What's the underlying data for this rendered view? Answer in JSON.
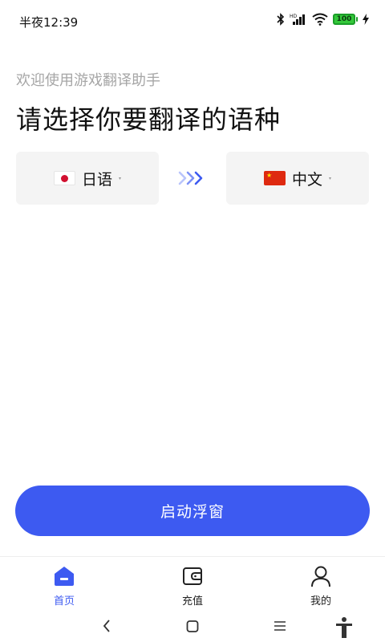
{
  "status_bar": {
    "time": "半夜12:39",
    "battery_level": "100",
    "icons": [
      "bluetooth-icon",
      "hd-signal-icon",
      "wifi-icon",
      "battery-icon",
      "charging-icon"
    ]
  },
  "header": {
    "subtitle": "欢迎使用游戏翻译助手",
    "title": "请选择你要翻译的语种"
  },
  "languages": {
    "source": {
      "label": "日语",
      "flag": "japan-flag-icon"
    },
    "target": {
      "label": "中文",
      "flag": "china-flag-icon"
    },
    "arrow_icon": "triple-chevron-right-icon"
  },
  "start_button": {
    "label": "启动浮窗"
  },
  "bottom_nav": {
    "items": [
      {
        "label": "首页",
        "icon": "home-icon",
        "active": true
      },
      {
        "label": "充值",
        "icon": "wallet-icon",
        "active": false
      },
      {
        "label": "我的",
        "icon": "user-icon",
        "active": false
      }
    ]
  },
  "system_nav": [
    "back-icon",
    "home-square-icon",
    "menu-icon",
    "accessibility-icon"
  ],
  "colors": {
    "accent": "#3d5af1",
    "subtitle_gray": "#a6a6a6",
    "selector_bg": "#f4f4f4",
    "battery_green": "#34c83a"
  }
}
